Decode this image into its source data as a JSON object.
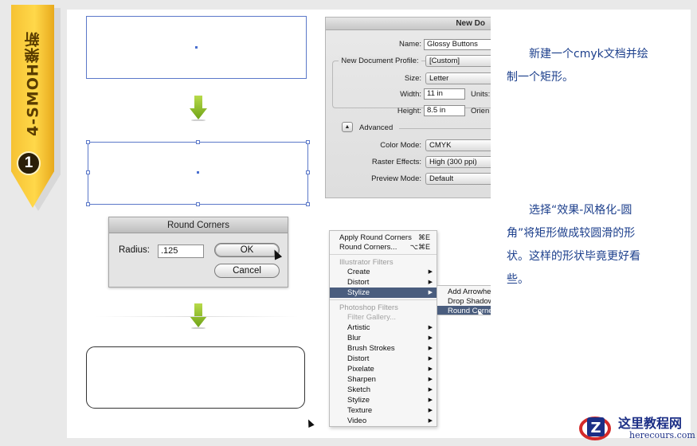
{
  "ribbon": {
    "text": "4-SMOH樂新",
    "step": "1"
  },
  "new_document": {
    "title": "New Do",
    "name_label": "Name:",
    "name_value": "Glossy Buttons",
    "profile_label": "New Document Profile:",
    "profile_value": "[Custom]",
    "size_label": "Size:",
    "size_value": "Letter",
    "width_label": "Width:",
    "width_value": "11 in",
    "units_label": "Units:",
    "height_label": "Height:",
    "height_value": "8.5 in",
    "orientation_label": "Orien",
    "advanced_label": "Advanced",
    "color_mode_label": "Color Mode:",
    "color_mode_value": "CMYK",
    "raster_label": "Raster Effects:",
    "raster_value": "High (300 ppi)",
    "preview_label": "Preview Mode:",
    "preview_value": "Default"
  },
  "round_corners": {
    "title": "Round Corners",
    "radius_label": "Radius:",
    "radius_value": ".125",
    "ok_label": "OK",
    "cancel_label": "Cancel"
  },
  "effect_menu": {
    "apply_label": "Apply Round Corners",
    "apply_shortcut": "⌘E",
    "round_label": "Round Corners...",
    "round_shortcut": "⌥⌘E",
    "illustrator_header": "Illustrator Filters",
    "illustrator_items": [
      "Create",
      "Distort",
      "Stylize"
    ],
    "photoshop_header": "Photoshop Filters",
    "filter_gallery": "Filter Gallery...",
    "photoshop_items": [
      "Artistic",
      "Blur",
      "Brush Strokes",
      "Distort",
      "Pixelate",
      "Sharpen",
      "Sketch",
      "Stylize",
      "Texture",
      "Video"
    ]
  },
  "stylize_submenu": {
    "items": [
      "Add Arrowhe",
      "Drop Shadow",
      "Round Corne"
    ]
  },
  "captions": {
    "step1_line1": "新建一个cmyk文档并绘",
    "step1_line2": "制一个矩形。",
    "step2_line1": "选择“效果-风格化-圆",
    "step2_line2": "角”将矩形做成较圆滑的形",
    "step2_line3": "状。这样的形状毕竟更好看",
    "step2_line4": "些。"
  },
  "logo": {
    "cn": "这里教程网",
    "en": "herecours.com"
  },
  "colors": {
    "accent_blue": "#1c3f8c",
    "ribbon_yellow": "#ffd84a",
    "arrow_green": "#8cbf2a",
    "menu_highlight": "#4a5d7e"
  }
}
